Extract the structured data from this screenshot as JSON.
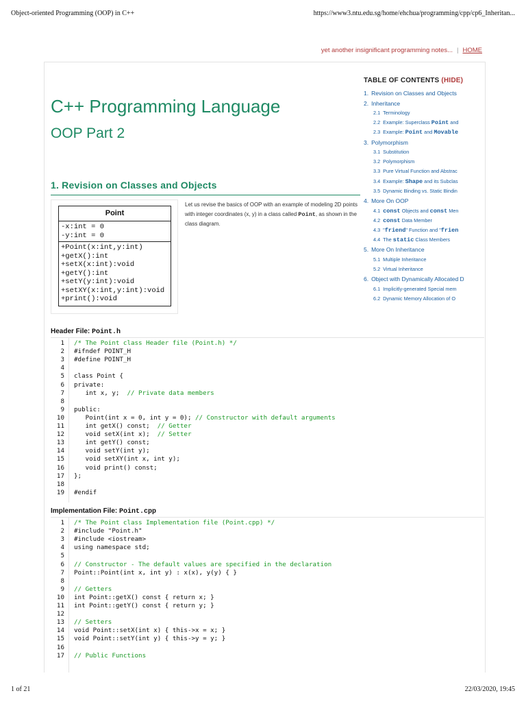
{
  "print_header": {
    "title": "Object-oriented Programming (OOP) in C++",
    "url": "https://www3.ntu.edu.sg/home/ehchua/programming/cpp/cp6_Inheritan..."
  },
  "top_nav": {
    "notes": "yet another insignificant programming notes...",
    "separator": "|",
    "home": "HOME"
  },
  "page": {
    "title": "C++ Programming Language",
    "subtitle": "OOP Part 2"
  },
  "section1": {
    "heading": "1.  Revision on Classes and Objects"
  },
  "uml": {
    "class_name": "Point",
    "attributes": [
      "-x:int = 0",
      "-y:int = 0"
    ],
    "methods": [
      "+Point(x:int,y:int)",
      "+getX():int",
      "+setX(x:int):void",
      "+getY():int",
      "+setY(y:int):void",
      "+setXY(x:int,y:int):void",
      "+print():void"
    ]
  },
  "intro": {
    "before": "Let us revise the basics of OOP with an example of modeling 2D points with integer coordinates (x, y) in a class called ",
    "code": "Point",
    "after": ", as shown in the class diagram."
  },
  "toc": {
    "heading": "TABLE OF CONTENTS",
    "hide": "(HIDE)",
    "items": [
      {
        "level": 1,
        "num": "1.",
        "parts": [
          "Revision on Classes and Objects"
        ]
      },
      {
        "level": 1,
        "num": "2.",
        "parts": [
          "Inheritance"
        ]
      },
      {
        "level": 2,
        "num": "2.1",
        "parts": [
          "Terminology"
        ]
      },
      {
        "level": 2,
        "num": "2.2",
        "parts": [
          "Example: Superclass ",
          {
            "code": "Point"
          },
          " and"
        ]
      },
      {
        "level": 2,
        "num": "2.3",
        "parts": [
          "Example: ",
          {
            "code": "Point"
          },
          " and ",
          {
            "code": "Movable"
          }
        ]
      },
      {
        "level": 1,
        "num": "3.",
        "parts": [
          "Polymorphism"
        ]
      },
      {
        "level": 2,
        "num": "3.1",
        "parts": [
          "Substitution"
        ]
      },
      {
        "level": 2,
        "num": "3.2",
        "parts": [
          "Polymorphism"
        ]
      },
      {
        "level": 2,
        "num": "3.3",
        "parts": [
          "Pure Virtual Function and Abstrac"
        ]
      },
      {
        "level": 2,
        "num": "3.4",
        "parts": [
          "Example: ",
          {
            "code": "Shape"
          },
          " and its Subclas"
        ]
      },
      {
        "level": 2,
        "num": "3.5",
        "parts": [
          "Dynamic Binding vs. Static Bindin"
        ]
      },
      {
        "level": 1,
        "num": "4.",
        "parts": [
          "More On OOP"
        ]
      },
      {
        "level": 2,
        "num": "4.1",
        "parts": [
          {
            "code": "const"
          },
          " Objects and ",
          {
            "code": "const"
          },
          " Men"
        ]
      },
      {
        "level": 2,
        "num": "4.2",
        "parts": [
          {
            "code": "const"
          },
          " Data Member"
        ]
      },
      {
        "level": 2,
        "num": "4.3",
        "parts": [
          "\"",
          {
            "code": "friend"
          },
          "\" Function and \"",
          {
            "code": "frien"
          }
        ]
      },
      {
        "level": 2,
        "num": "4.4",
        "parts": [
          "The ",
          {
            "code": "static"
          },
          " Class Members"
        ]
      },
      {
        "level": 1,
        "num": "5.",
        "parts": [
          "More On Inheritance"
        ]
      },
      {
        "level": 2,
        "num": "5.1",
        "parts": [
          "Multiple Inheritance"
        ]
      },
      {
        "level": 2,
        "num": "5.2",
        "parts": [
          "Virtual Inheritance"
        ]
      },
      {
        "level": 1,
        "num": "6.",
        "parts": [
          "Object with Dynamically Allocated D"
        ]
      },
      {
        "level": 2,
        "num": "6.1",
        "parts": [
          "Implicitly-generated Special mem"
        ]
      },
      {
        "level": 2,
        "num": "6.2",
        "parts": [
          "Dynamic Memory Allocation of O"
        ]
      }
    ]
  },
  "header_file": {
    "label": "Header File: ",
    "filename": "Point.h",
    "lines": [
      {
        "n": "1",
        "t": "/* The Point class Header file (Point.h) */",
        "c": "comment"
      },
      {
        "n": "2",
        "t": "#ifndef POINT_H"
      },
      {
        "n": "3",
        "t": "#define POINT_H"
      },
      {
        "n": "4",
        "t": ""
      },
      {
        "n": "5",
        "t": "class Point {"
      },
      {
        "n": "6",
        "t": "private:"
      },
      {
        "n": "7",
        "t": "   int x, y;",
        "cm": "  // Private data members"
      },
      {
        "n": "8",
        "t": ""
      },
      {
        "n": "9",
        "t": "public:"
      },
      {
        "n": "10",
        "t": "   Point(int x = 0, int y = 0);",
        "cm": " // Constructor with default arguments"
      },
      {
        "n": "11",
        "t": "   int getX() const;",
        "cm": "  // Getter"
      },
      {
        "n": "12",
        "t": "   void setX(int x);",
        "cm": "  // Setter"
      },
      {
        "n": "13",
        "t": "   int getY() const;"
      },
      {
        "n": "14",
        "t": "   void setY(int y);"
      },
      {
        "n": "15",
        "t": "   void setXY(int x, int y);"
      },
      {
        "n": "16",
        "t": "   void print() const;"
      },
      {
        "n": "17",
        "t": "};"
      },
      {
        "n": "18",
        "t": ""
      },
      {
        "n": "19",
        "t": "#endif"
      }
    ]
  },
  "impl_file": {
    "label": "Implementation File: ",
    "filename": "Point.cpp",
    "lines": [
      {
        "n": "1",
        "t": "/* The Point class Implementation file (Point.cpp) */",
        "c": "comment"
      },
      {
        "n": "2",
        "t": "#include \"Point.h\""
      },
      {
        "n": "3",
        "t": "#include <iostream>"
      },
      {
        "n": "4",
        "t": "using namespace std;"
      },
      {
        "n": "5",
        "t": ""
      },
      {
        "n": "6",
        "t": "// Constructor - The default values are specified in the declaration",
        "c": "comment"
      },
      {
        "n": "7",
        "t": "Point::Point(int x, int y) : x(x), y(y) { }"
      },
      {
        "n": "8",
        "t": ""
      },
      {
        "n": "9",
        "t": "// Getters",
        "c": "comment"
      },
      {
        "n": "10",
        "t": "int Point::getX() const { return x; }"
      },
      {
        "n": "11",
        "t": "int Point::getY() const { return y; }"
      },
      {
        "n": "12",
        "t": ""
      },
      {
        "n": "13",
        "t": "// Setters",
        "c": "comment"
      },
      {
        "n": "14",
        "t": "void Point::setX(int x) { this->x = x; }"
      },
      {
        "n": "15",
        "t": "void Point::setY(int y) { this->y = y; }"
      },
      {
        "n": "16",
        "t": ""
      },
      {
        "n": "17",
        "t": "// Public Functions",
        "c": "comment"
      }
    ]
  },
  "print_footer": {
    "page": "1 of 21",
    "date": "22/03/2020, 19:45"
  },
  "colors": {
    "heading_green": "#1f8a64",
    "link_blue": "#1c5fa0",
    "accent_red": "#b03a3a",
    "comment_green": "#1f9a2a"
  }
}
